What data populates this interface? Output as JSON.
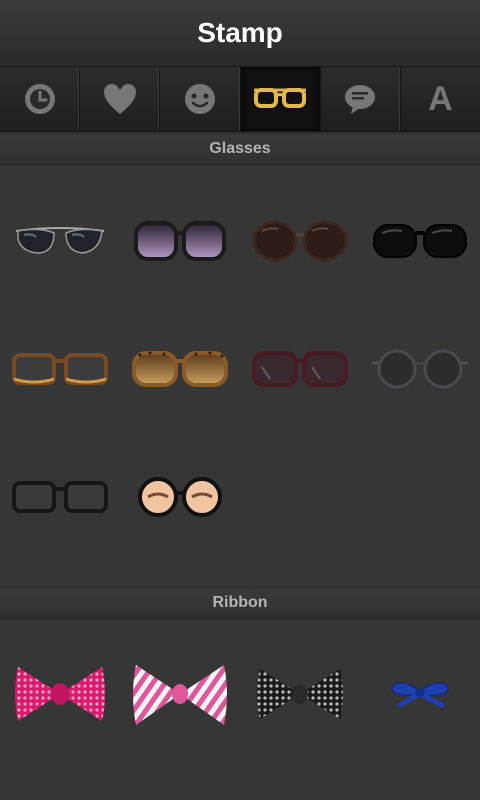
{
  "header": {
    "title": "Stamp"
  },
  "tabs": [
    {
      "name": "recent",
      "icon": "clock-icon"
    },
    {
      "name": "favorites",
      "icon": "heart-icon"
    },
    {
      "name": "faces",
      "icon": "face-icon"
    },
    {
      "name": "glasses",
      "icon": "glasses-icon",
      "active": true
    },
    {
      "name": "speech",
      "icon": "speech-bubble-icon"
    },
    {
      "name": "text",
      "icon": "letter-a-icon",
      "label": "A"
    }
  ],
  "sections": {
    "glasses": {
      "title": "Glasses",
      "items": [
        "aviator-sunglasses",
        "purple-sunglasses",
        "brown-round-sunglasses",
        "black-sunglasses",
        "tortoise-frame-glasses",
        "leopard-sunglasses",
        "burgundy-sunglasses",
        "round-wire-glasses",
        "black-frame-glasses",
        "funny-eyes-glasses"
      ]
    },
    "ribbon": {
      "title": "Ribbon",
      "items": [
        "pink-sequin-bow",
        "pink-striped-bow",
        "black-sequin-bow",
        "blue-ribbon-bow"
      ]
    }
  }
}
